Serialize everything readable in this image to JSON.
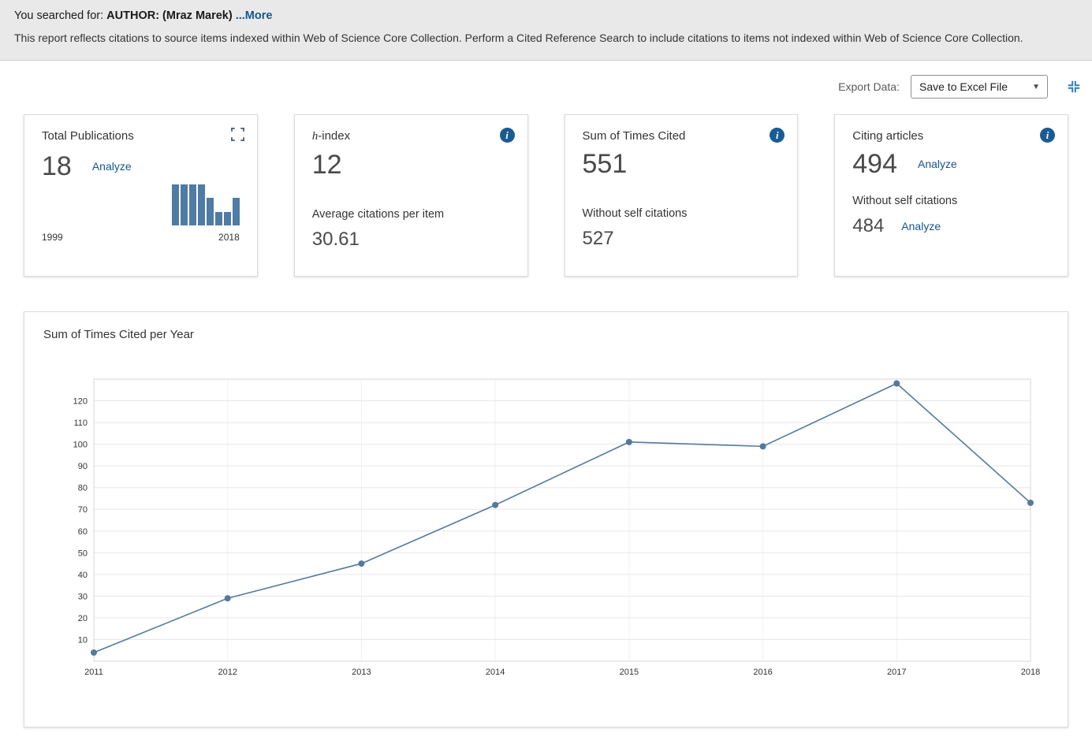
{
  "header": {
    "prefix": "You searched for:",
    "query": "AUTHOR: (Mraz Marek)",
    "more": "...More",
    "note": "This report reflects citations to source items indexed within Web of Science Core Collection. Perform a Cited Reference Search to include citations to items not indexed within Web of Science Core Collection."
  },
  "export": {
    "label": "Export Data:",
    "selected": "Save to Excel File"
  },
  "cards": {
    "total_publications": {
      "title": "Total Publications",
      "value": "18",
      "analyze": "Analyze",
      "year_start": "1999",
      "year_end": "2018"
    },
    "h_index": {
      "title_prefix": "h",
      "title_suffix": "-index",
      "value": "12",
      "sub_label": "Average citations per item",
      "sub_value": "30.61"
    },
    "sum_times_cited": {
      "title": "Sum of Times Cited",
      "value": "551",
      "sub_label": "Without self citations",
      "sub_value": "527"
    },
    "citing_articles": {
      "title": "Citing articles",
      "value": "494",
      "analyze": "Analyze",
      "sub_label": "Without self citations",
      "sub_value": "484",
      "analyze2": "Analyze"
    }
  },
  "citation_chart": {
    "title": "Sum of Times Cited per Year"
  },
  "chart_data": [
    {
      "type": "bar",
      "title": "Total Publications per year (mini histogram)",
      "x_axis_range": [
        "1999",
        "2018"
      ],
      "values": [
        3,
        3,
        3,
        3,
        2,
        1,
        1,
        2
      ]
    },
    {
      "type": "line",
      "title": "Sum of Times Cited per Year",
      "x": [
        2011,
        2012,
        2013,
        2014,
        2015,
        2016,
        2017,
        2018
      ],
      "values": [
        4,
        29,
        45,
        72,
        101,
        99,
        128,
        73
      ],
      "ylim": [
        0,
        130
      ],
      "yticks": [
        10,
        20,
        30,
        40,
        50,
        60,
        70,
        80,
        90,
        100,
        110,
        120
      ],
      "grid": true,
      "legend": "none"
    }
  ],
  "colors": {
    "accent_blue": "#15558f",
    "chart_line": "#54799c",
    "bar_fill": "#4f7ba5",
    "info_bg": "#1a5b94",
    "icon_blue": "#2e7cb8"
  }
}
